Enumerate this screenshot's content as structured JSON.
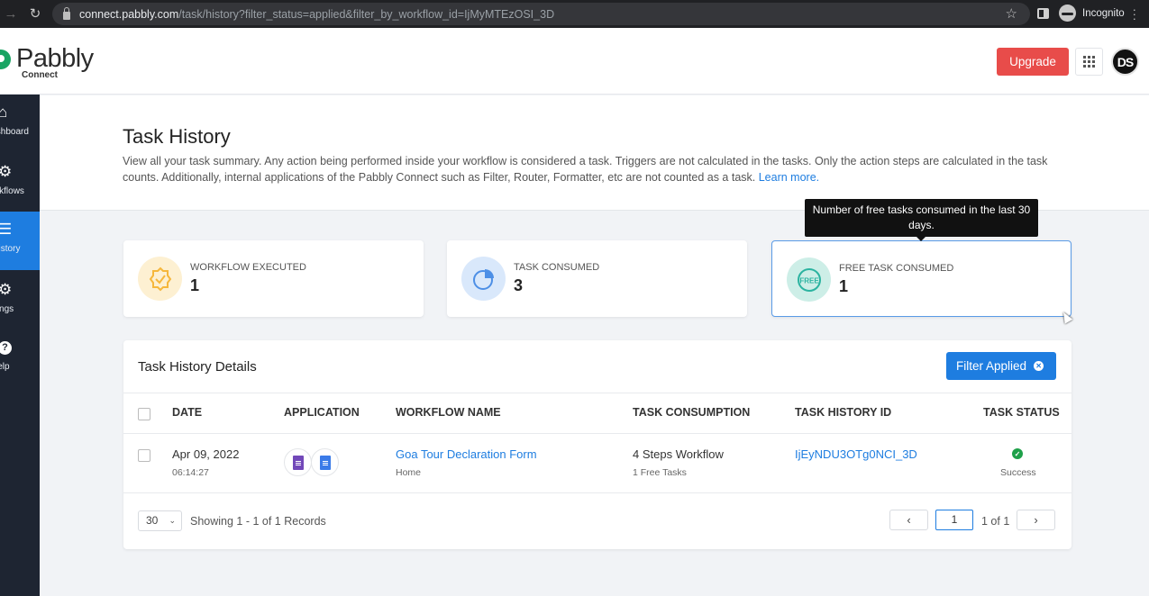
{
  "browser": {
    "url_host": "connect.pabbly.com",
    "url_path": "/task/history?filter_status=applied&filter_by_workflow_id=IjMyMTEzOSI_3D",
    "profile_label": "Incognito",
    "icons": [
      "back-arrow-icon",
      "forward-arrow-icon",
      "reload-icon",
      "lock-icon",
      "star-icon",
      "sidebar-toggle-icon",
      "incognito-icon"
    ]
  },
  "header": {
    "logo_name": "Pabbly",
    "logo_sub": "Connect",
    "upgrade_label": "Upgrade",
    "avatar_initials": "DS",
    "icons": [
      "apps-grid-icon"
    ],
    "colors": {
      "upgrade": "#e84c4a",
      "brand_green": "#19a463"
    }
  },
  "sidebar": {
    "items": [
      {
        "label": "Dashboard",
        "icon": "home-icon",
        "glyph": "⌂",
        "active": false
      },
      {
        "label": "Workflows",
        "icon": "workflow-icon",
        "glyph": "⚙",
        "active": false
      },
      {
        "label": "Task History",
        "icon": "list-icon",
        "glyph": "☰",
        "active": true
      },
      {
        "label": "Settings",
        "icon": "gear-icon",
        "glyph": "⚙",
        "active": false
      },
      {
        "label": "Help",
        "icon": "question-icon",
        "glyph": "?",
        "active": false
      }
    ],
    "colors": {
      "bg": "#1e2532",
      "active": "#1e7de0"
    }
  },
  "page": {
    "title": "Task History",
    "description": "View all your task summary. Any action being performed inside your workflow is considered a task. Triggers are not calculated in the tasks. Only the action steps are calculated in the task counts. Additionally, internal applications of the Pabbly Connect such as Filter, Router, Formatter, etc are not counted as a task.",
    "learn_more": "Learn more."
  },
  "stats": [
    {
      "label": "WORKFLOW EXECUTED",
      "value": "1",
      "icon": "badge-check-icon",
      "color": "#f6b73c"
    },
    {
      "label": "TASK CONSUMED",
      "value": "3",
      "icon": "pie-chart-icon",
      "color": "#4d8fe6"
    },
    {
      "label": "FREE TASK CONSUMED",
      "value": "1",
      "icon": "free-badge-icon",
      "color": "#2bb3a0"
    }
  ],
  "tooltip": {
    "text": "Number of free tasks consumed in the last 30 days."
  },
  "details": {
    "title": "Task History Details",
    "filter_label": "Filter Applied",
    "columns": [
      "DATE",
      "APPLICATION",
      "WORKFLOW NAME",
      "TASK CONSUMPTION",
      "TASK HISTORY ID",
      "TASK STATUS"
    ],
    "rows": [
      {
        "date": "Apr 09, 2022",
        "time": "06:14:27",
        "apps": [
          "google-forms-icon",
          "google-docs-icon"
        ],
        "workflow_name": "Goa Tour Declaration Form",
        "workflow_folder": "Home",
        "consumption": "4 Steps Workflow",
        "free_tasks": "1 Free Tasks",
        "history_id": "IjEyNDU3OTg0NCI_3D",
        "status": "Success"
      }
    ],
    "per_page": "30",
    "showing": "Showing 1 - 1 of 1 Records",
    "page_value": "1",
    "page_of": "1 of 1"
  }
}
